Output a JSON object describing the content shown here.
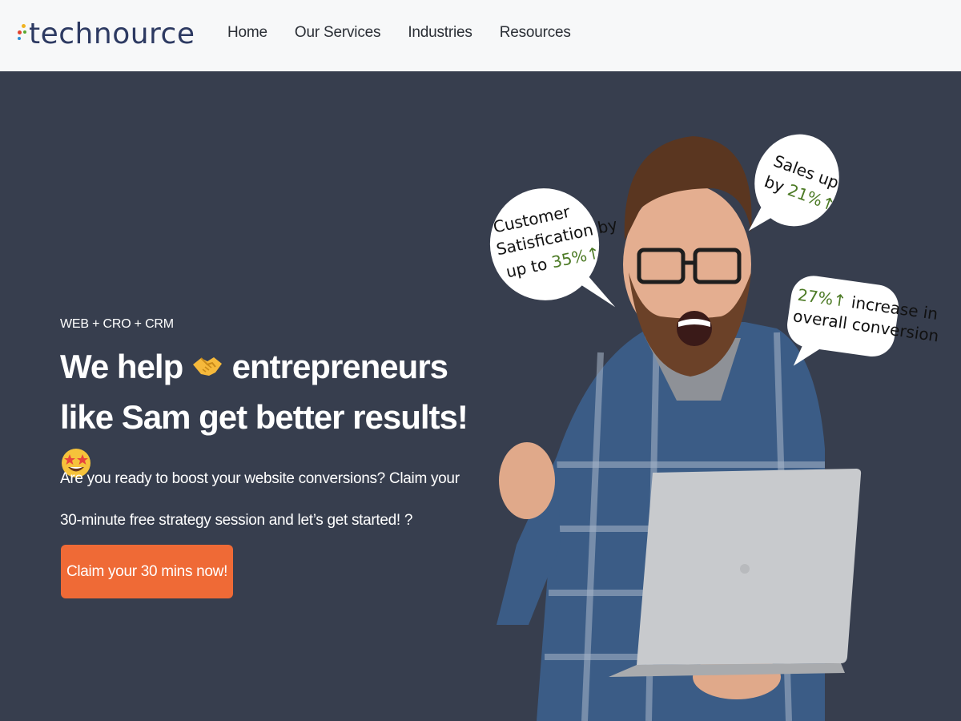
{
  "header": {
    "brand": "technource",
    "nav": [
      {
        "label": "Home"
      },
      {
        "label": "Our Services"
      },
      {
        "label": "Industries"
      },
      {
        "label": "Resources"
      }
    ]
  },
  "hero": {
    "eyebrow": "WEB + CRO + CRM",
    "title_part1": "We help",
    "title_part2": "entrepreneurs like Sam get better results!",
    "description": "Are you ready to boost your website conversions? Claim your 30-minute free strategy session and let’s get started! ?",
    "cta_label": "Claim your 30 mins now!"
  },
  "bubbles": {
    "satisfaction": {
      "line1": "Customer",
      "line2": "Satisfication by",
      "line3_prefix": "up to",
      "value": "35%↑"
    },
    "sales": {
      "line1": "Sales up",
      "line2_prefix": "by",
      "value": "21%↑"
    },
    "conversion": {
      "value": "27%↑",
      "line1_suffix": "increase in",
      "line2": "overall conversion"
    }
  },
  "colors": {
    "hero_bg": "#373e4e",
    "header_bg": "#f7f8f9",
    "cta": "#ef6a36",
    "accent_green": "#4c7a25"
  }
}
